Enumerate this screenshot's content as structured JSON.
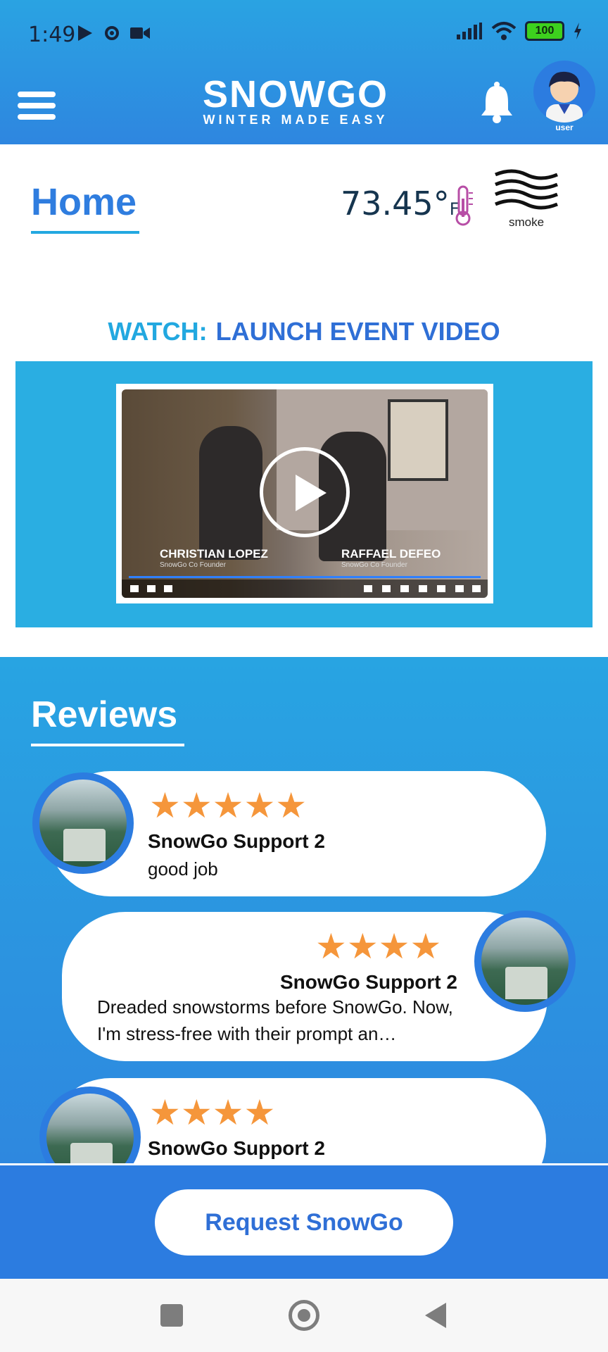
{
  "status_bar": {
    "time": "1:49",
    "battery": "100"
  },
  "app": {
    "name": "SNOWGO",
    "tagline": "WINTER MADE EASY",
    "avatar_label": "user"
  },
  "home": {
    "title": "Home",
    "temperature": "73.45°",
    "temperature_unit": "F",
    "condition": "smoke"
  },
  "watch": {
    "prefix": "WATCH:",
    "title": "LAUNCH EVENT VIDEO"
  },
  "video": {
    "person_1_name": "CHRISTIAN LOPEZ",
    "person_1_role": "SnowGo Co Founder",
    "person_2_name": "RAFFAEL DEFEO",
    "person_2_role": "SnowGo Co Founder"
  },
  "reviews": {
    "title": "Reviews",
    "items": [
      {
        "name": "SnowGo Support 2",
        "rating": 5,
        "stars": "★★★★★",
        "text": "good job"
      },
      {
        "name": "SnowGo Support 2",
        "rating": 4,
        "stars": "★★★★",
        "text": "Dreaded snowstorms before SnowGo. Now, I'm stress-free with their prompt an…"
      },
      {
        "name": "SnowGo Support 2",
        "rating": 4,
        "stars": "★★★★",
        "text": ""
      }
    ]
  },
  "cta": {
    "label": "Request SnowGo"
  },
  "colors": {
    "primary": "#2f7ddf",
    "accent": "#22a8e0",
    "star": "#f5963b"
  }
}
